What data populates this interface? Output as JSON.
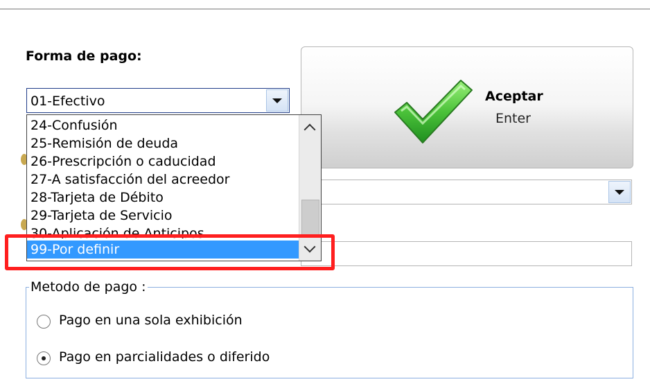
{
  "form": {
    "forma_de_pago_label": "Forma de pago:",
    "forma_de_pago_value": "01-Efectivo"
  },
  "dropdown": {
    "items": [
      {
        "label": "24-Confusión"
      },
      {
        "label": "25-Remisión de deuda"
      },
      {
        "label": "26-Prescripción o caducidad"
      },
      {
        "label": "27-A satisfacción del acreedor"
      },
      {
        "label": "28-Tarjeta de Débito"
      },
      {
        "label": "29-Tarjeta de Servicio"
      },
      {
        "label": "30-Aplicación de Anticipos"
      }
    ],
    "selected_item": "99-Por definir"
  },
  "accept_button": {
    "title": "Aceptar",
    "shortcut": "Enter",
    "icon": "checkmark-icon"
  },
  "metodo_pago": {
    "legend": "Metodo de pago :",
    "options": [
      {
        "label": "Pago en una sola exhibición",
        "selected": false
      },
      {
        "label": "Pago en parcialidades o diferido",
        "selected": true
      }
    ]
  },
  "colors": {
    "selection": "#3399ff",
    "highlight_box": "#ff1f1f",
    "checkmark": "#3cb043"
  }
}
